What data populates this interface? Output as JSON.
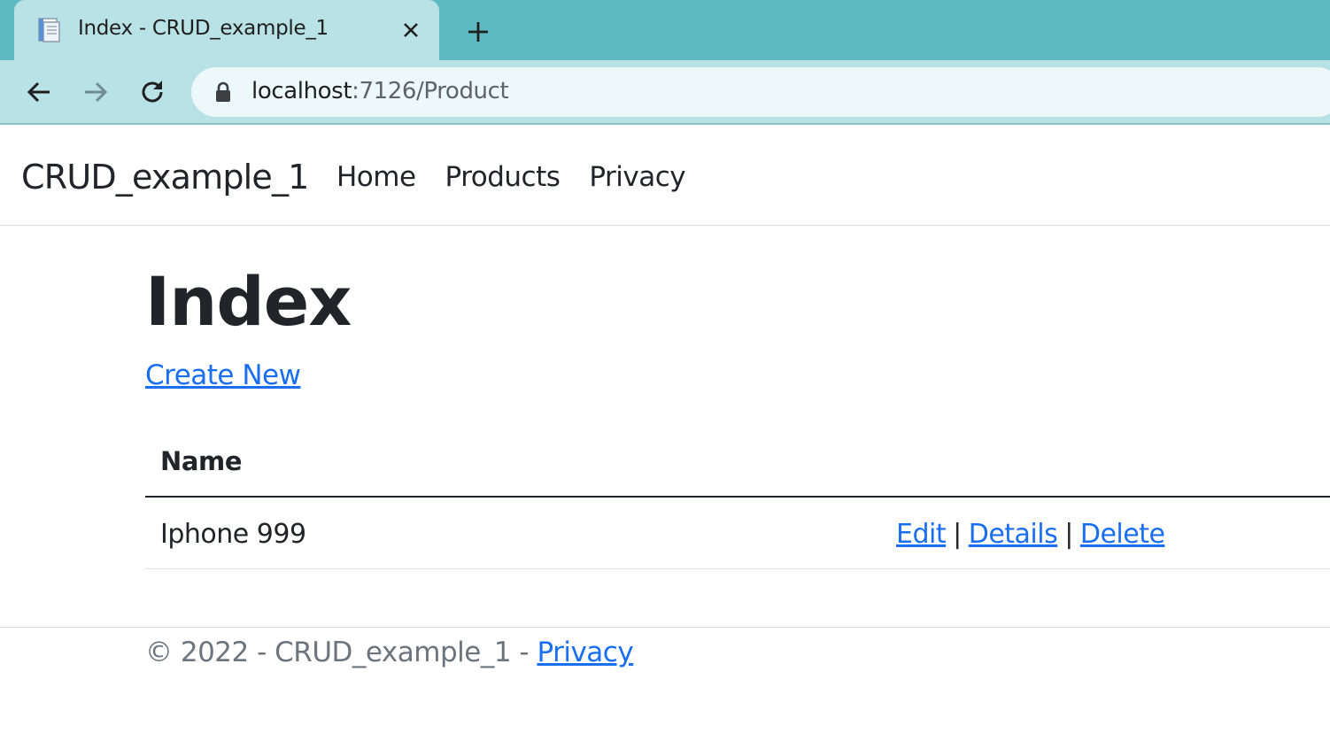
{
  "browser": {
    "tab_title": "Index - CRUD_example_1",
    "url_host": "localhost",
    "url_rest": ":7126/Product"
  },
  "navbar": {
    "brand": "CRUD_example_1",
    "links": [
      "Home",
      "Products",
      "Privacy"
    ]
  },
  "main": {
    "title": "Index",
    "create_new": "Create New",
    "table": {
      "header_name": "Name",
      "rows": [
        {
          "name": "Iphone 999",
          "edit": "Edit",
          "details": "Details",
          "delete": "Delete",
          "separator": "|"
        }
      ]
    }
  },
  "footer": {
    "text": "© 2022 - CRUD_example_1 - ",
    "privacy": "Privacy"
  },
  "colors": {
    "tabstrip": "#5dbac2",
    "toolbar": "#b8e2e6",
    "link": "#1a6ef0",
    "text": "#212529"
  }
}
